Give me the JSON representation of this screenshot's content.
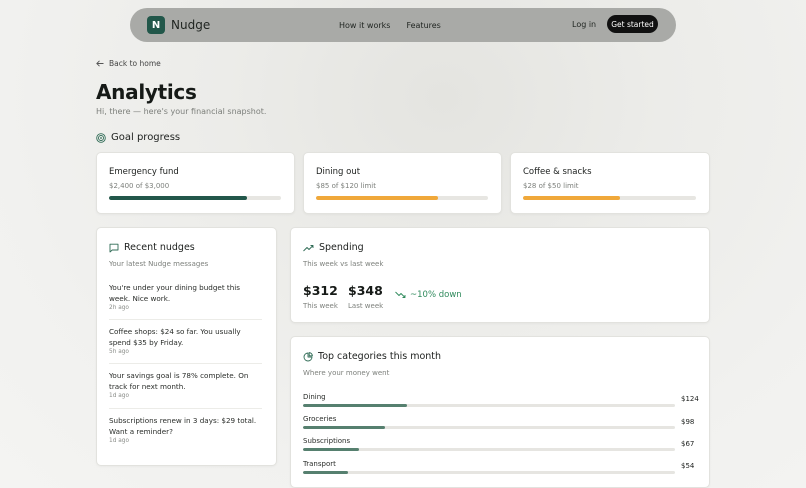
{
  "nav": {
    "logo_letter": "N",
    "brand": "Nudge",
    "links": [
      "How it works",
      "Features"
    ],
    "login": "Log in",
    "cta": "Get started"
  },
  "back_link": "Back to home",
  "page": {
    "title": "Analytics",
    "subtitle": "Hi, there — here's your financial snapshot."
  },
  "goals": {
    "heading": "Goal progress",
    "items": [
      {
        "title": "Emergency fund",
        "detail": "$2,400 of $3,000",
        "progress": 0.8,
        "color": "#22574a"
      },
      {
        "title": "Dining out",
        "detail": "$85 of $120 limit",
        "progress": 0.71,
        "color": "#f0a83a"
      },
      {
        "title": "Coffee & snacks",
        "detail": "$28 of $50 limit",
        "progress": 0.56,
        "color": "#f0a83a"
      }
    ]
  },
  "nudges": {
    "heading": "Recent nudges",
    "subtitle": "Your latest Nudge messages",
    "items": [
      {
        "text": "You're under your dining budget this week. Nice work.",
        "time": "2h ago"
      },
      {
        "text": "Coffee shops: $24 so far. You usually spend $35 by Friday.",
        "time": "5h ago"
      },
      {
        "text": "Your savings goal is 78% complete. On track for next month.",
        "time": "1d ago"
      },
      {
        "text": "Subscriptions renew in 3 days: $29 total. Want a reminder?",
        "time": "1d ago"
      }
    ]
  },
  "spending": {
    "heading": "Spending",
    "subtitle": "This week vs last week",
    "this_week_value": "$312",
    "this_week_label": "This week",
    "last_week_value": "$348",
    "last_week_label": "Last week",
    "change": "~10% down",
    "change_color": "#2f8a5c"
  },
  "categories": {
    "heading": "Top categories this month",
    "subtitle": "Where your money went",
    "items": [
      {
        "name": "Dining",
        "value": "$124",
        "share": 0.28
      },
      {
        "name": "Groceries",
        "value": "$98",
        "share": 0.22
      },
      {
        "name": "Subscriptions",
        "value": "$67",
        "share": 0.15
      },
      {
        "name": "Transport",
        "value": "$54",
        "share": 0.12
      }
    ]
  }
}
